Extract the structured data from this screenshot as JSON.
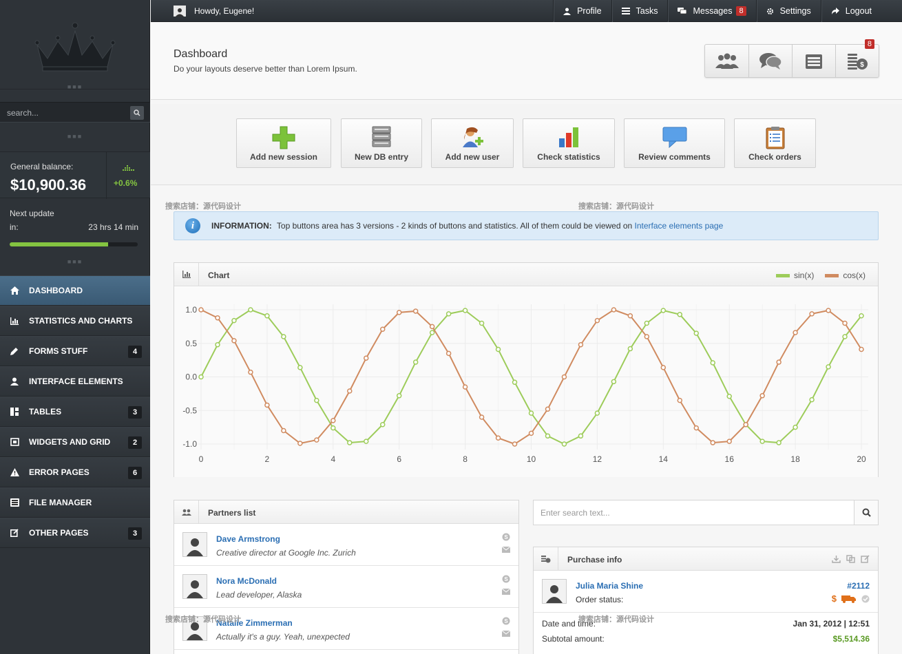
{
  "sidebar": {
    "search_placeholder": "search...",
    "balance_label": "General balance:",
    "balance_value": "$10,900.36",
    "balance_change": "+0.6%",
    "next_update_label_1": "Next update",
    "next_update_label_2": "in:",
    "next_update_value": "23 hrs 14 min",
    "progress_fraction": 0.77,
    "nav": [
      {
        "label": "Dashboard",
        "icon": "home-icon",
        "badge": "",
        "active": true
      },
      {
        "label": "Statistics and charts",
        "icon": "bar-chart-icon",
        "badge": ""
      },
      {
        "label": "Forms stuff",
        "icon": "pencil-icon",
        "badge": "4"
      },
      {
        "label": "Interface elements",
        "icon": "user-icon",
        "badge": ""
      },
      {
        "label": "Tables",
        "icon": "grid-icon",
        "badge": "3"
      },
      {
        "label": "Widgets and grid",
        "icon": "widget-icon",
        "badge": "2"
      },
      {
        "label": "Error pages",
        "icon": "warning-icon",
        "badge": "6"
      },
      {
        "label": "File manager",
        "icon": "cabinet-icon",
        "badge": ""
      },
      {
        "label": "Other pages",
        "icon": "edit-icon",
        "badge": "3"
      }
    ]
  },
  "topbar": {
    "greeting": "Howdy, Eugene!",
    "profile": "Profile",
    "tasks": "Tasks",
    "messages": "Messages",
    "messages_count": "8",
    "settings": "Settings",
    "logout": "Logout"
  },
  "header": {
    "title": "Dashboard",
    "subtitle": "Do your layouts deserve better than Lorem Ipsum.",
    "stat_badge": "8"
  },
  "big_buttons": [
    "Add new session",
    "New DB entry",
    "Add new user",
    "Check statistics",
    "Review comments",
    "Check orders"
  ],
  "watermarks": [
    "搜索店铺：源代码设计",
    "搜索店铺：源代码设计",
    "搜索店铺：源代码设计",
    "搜索店铺：源代码设计"
  ],
  "info": {
    "label": "INFORMATION:",
    "text": "Top buttons area has 3 versions - 2 kinds of buttons and statistics. All of them could be viewed on",
    "link": "Interface elements page"
  },
  "chart_widget": {
    "title": "Chart"
  },
  "chart_data": {
    "type": "line",
    "xlim": [
      0,
      20
    ],
    "ylim": [
      -1,
      1
    ],
    "xticks": [
      0,
      2,
      4,
      6,
      8,
      10,
      12,
      14,
      16,
      18,
      20
    ],
    "yticks": [
      1.0,
      0.5,
      0.0,
      -0.5,
      -1.0
    ],
    "ytick_labels": [
      "1.0",
      "0.5",
      "0.0",
      "-0.5",
      "-1.0"
    ],
    "grid": true,
    "legend": "top-right",
    "series": [
      {
        "name": "sin(x)",
        "color": "#9dcc5a",
        "function": "sin"
      },
      {
        "name": "cos(x)",
        "color": "#d08b60",
        "function": "cos"
      }
    ],
    "x": [
      0,
      0.5,
      1,
      1.5,
      2,
      2.5,
      3,
      3.5,
      4,
      4.5,
      5,
      5.5,
      6,
      6.5,
      7,
      7.5,
      8,
      8.5,
      9,
      9.5,
      10,
      10.5,
      11,
      11.5,
      12,
      12.5,
      13,
      13.5,
      14,
      14.5,
      15,
      15.5,
      16,
      16.5,
      17,
      17.5,
      18,
      18.5,
      19,
      19.5,
      20
    ],
    "sin": [
      0.0,
      0.48,
      0.84,
      1.0,
      0.91,
      0.6,
      0.14,
      -0.35,
      -0.76,
      -0.98,
      -0.96,
      -0.71,
      -0.28,
      0.22,
      0.66,
      0.94,
      0.99,
      0.8,
      0.41,
      -0.08,
      -0.54,
      -0.88,
      -1.0,
      -0.88,
      -0.54,
      -0.07,
      0.42,
      0.8,
      0.99,
      0.93,
      0.65,
      0.21,
      -0.29,
      -0.71,
      -0.96,
      -0.98,
      -0.75,
      -0.34,
      0.15,
      0.6,
      0.91
    ],
    "cos": [
      1.0,
      0.88,
      0.54,
      0.07,
      -0.42,
      -0.8,
      -0.99,
      -0.94,
      -0.65,
      -0.21,
      0.28,
      0.71,
      0.96,
      0.98,
      0.75,
      0.35,
      -0.15,
      -0.6,
      -0.91,
      -1.0,
      -0.84,
      -0.48,
      0.0,
      0.48,
      0.84,
      1.0,
      0.91,
      0.6,
      0.14,
      -0.35,
      -0.76,
      -0.98,
      -0.96,
      -0.71,
      -0.28,
      0.22,
      0.66,
      0.94,
      0.99,
      0.8,
      0.41
    ]
  },
  "partners": {
    "title": "Partners list",
    "items": [
      {
        "name": "Dave Armstrong",
        "role": "Creative director at Google Inc. Zurich"
      },
      {
        "name": "Nora McDonald",
        "role": "Lead developer, Alaska"
      },
      {
        "name": "Natalie Zimmerman",
        "role": "Actually it's a guy. Yeah, unexpected"
      }
    ]
  },
  "search2": {
    "placeholder": "Enter search text..."
  },
  "purchase": {
    "title": "Purchase info",
    "name": "Julia Maria Shine",
    "order_id": "#2112",
    "order_status_label": "Order status:",
    "status_currency": "$",
    "date_label": "Date and time:",
    "date_value": "Jan 31, 2012 | 12:51",
    "subtotal_label": "Subtotal amount:",
    "subtotal_value": "$5,514.36"
  },
  "colors": {
    "accent": "#84c441",
    "link": "#2a6eb3",
    "badge_red": "#c12e2a",
    "sin": "#9dcc5a",
    "cos": "#d08b60"
  }
}
